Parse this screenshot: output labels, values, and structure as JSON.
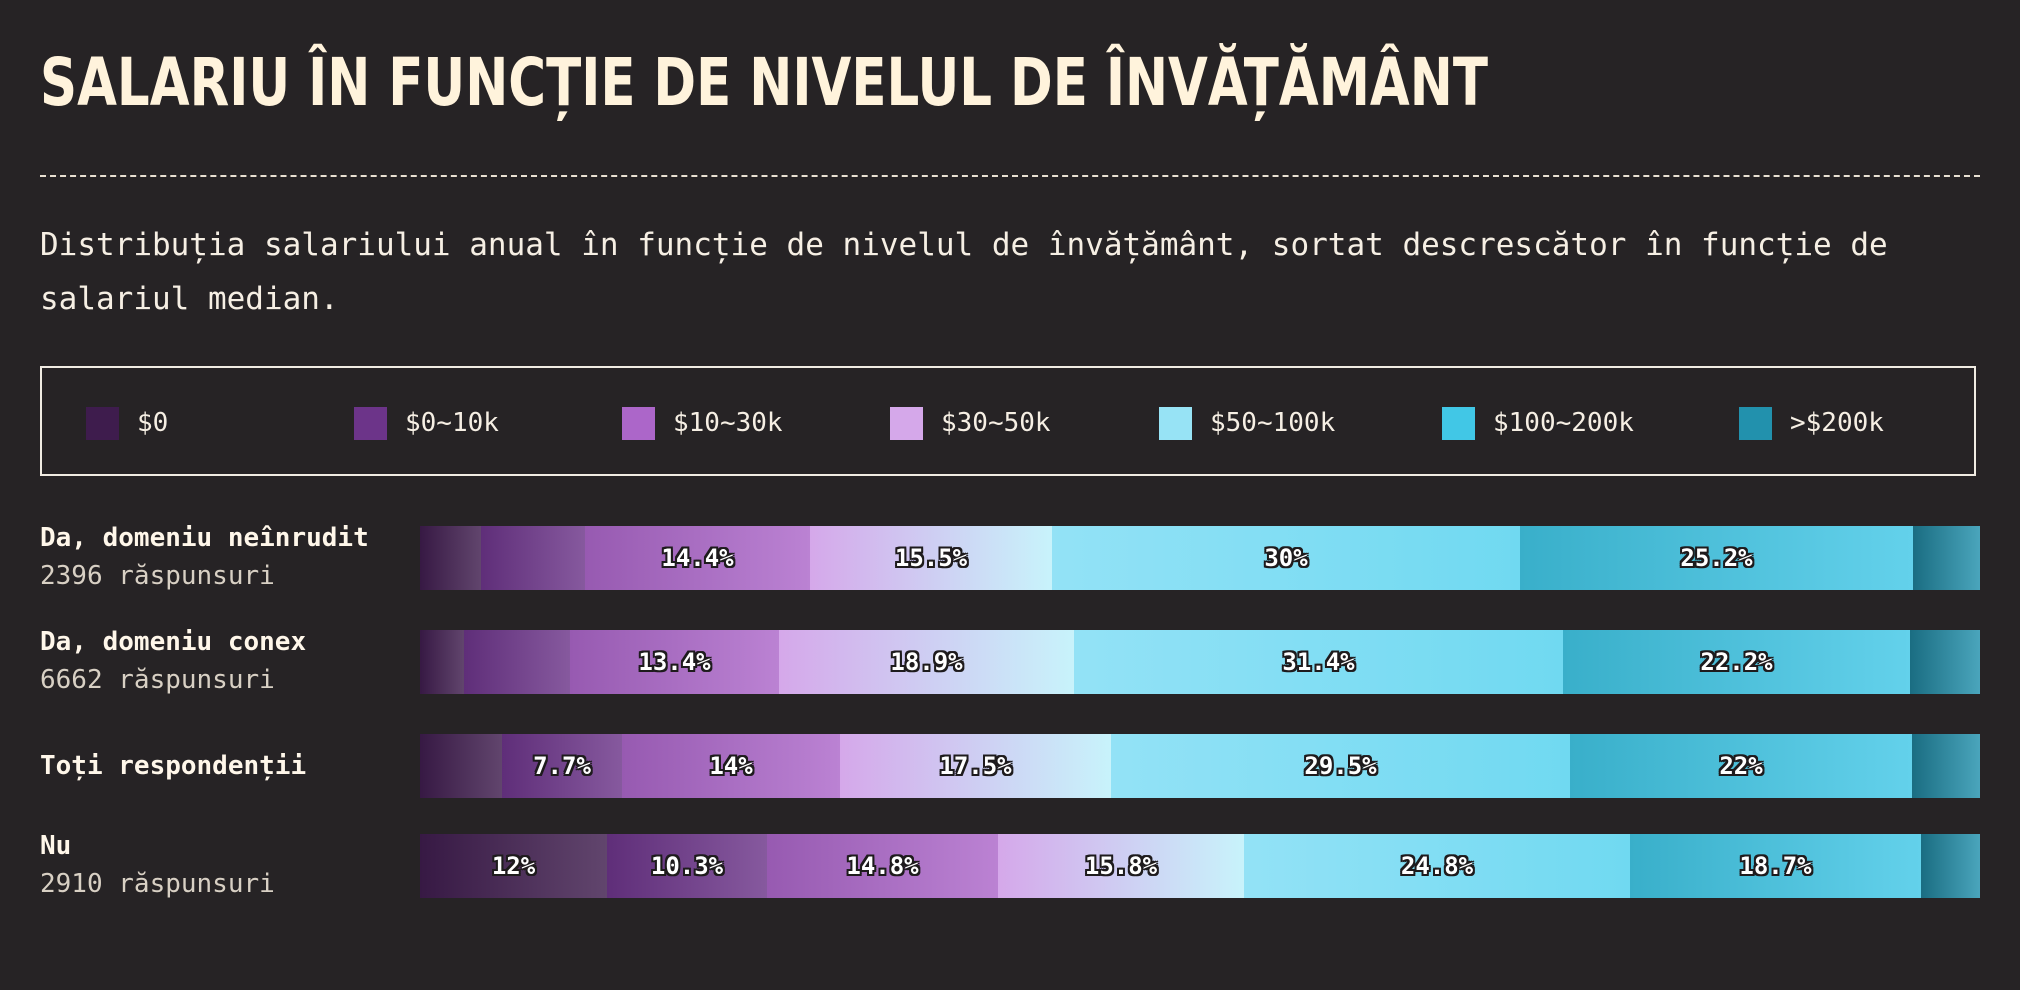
{
  "title": "SALARIU ÎN FUNCȚIE DE NIVELUL DE ÎNVĂȚĂMÂNT",
  "subtitle": "Distribuția salariului anual în funcție de nivelul de învățământ, sortat descrescător în funcție de salariul median.",
  "colors": {
    "background": "#262325",
    "text": "#fff3dc",
    "label_outline": "#1e1b1d"
  },
  "legend": [
    {
      "label": "$0",
      "color": "#3e1c4d"
    },
    {
      "label": "$0~10k",
      "color": "#6c3489"
    },
    {
      "label": "$10~30k",
      "color": "#ac66c9"
    },
    {
      "label": "$30~50k",
      "color": "#d5a8ea"
    },
    {
      "label": "$50~100k",
      "color": "#97e3f5"
    },
    {
      "label": "$100~200k",
      "color": "#41c7e6"
    },
    {
      "label": ">$200k",
      "color": "#2291ad"
    }
  ],
  "chart_data": {
    "type": "bar",
    "orientation": "horizontal",
    "stacked": true,
    "normalized": true,
    "title": "SALARIU ÎN FUNCȚIE DE NIVELUL DE ÎNVĂȚĂMÂNT",
    "subtitle": "Distribuția salariului anual în funcție de nivelul de învățământ, sortat descrescător în funcție de salariul median.",
    "xlim": [
      0,
      100
    ],
    "grid": false,
    "legend_position": "top",
    "series_names": [
      "$0",
      "$0~10k",
      "$10~30k",
      "$30~50k",
      "$50~100k",
      "$100~200k",
      ">$200k"
    ],
    "rows": [
      {
        "name": "Da, domeniu neînrudit",
        "count_text": "2396 răspunsuri",
        "values": [
          3.9,
          6.7,
          14.4,
          15.5,
          30,
          25.2,
          4.3
        ],
        "labels": [
          "",
          "",
          "14.4%",
          "15.5%",
          "30%",
          "25.2%",
          ""
        ]
      },
      {
        "name": "Da, domeniu conex",
        "count_text": "6662 răspunsuri",
        "values": [
          2.8,
          6.8,
          13.4,
          18.9,
          31.4,
          22.2,
          4.5
        ],
        "labels": [
          "",
          "",
          "13.4%",
          "18.9%",
          "31.4%",
          "22.2%",
          ""
        ]
      },
      {
        "name": "Toți respondenții",
        "count_text": "",
        "values": [
          5.3,
          7.7,
          14,
          17.5,
          29.5,
          22,
          4.4
        ],
        "labels": [
          "",
          "7.7%",
          "14%",
          "17.5%",
          "29.5%",
          "22%",
          ""
        ]
      },
      {
        "name": "Nu",
        "count_text": "2910 răspunsuri",
        "values": [
          12,
          10.3,
          14.8,
          15.8,
          24.8,
          18.7,
          3.8
        ],
        "labels": [
          "12%",
          "10.3%",
          "14.8%",
          "15.8%",
          "24.8%",
          "18.7%",
          ""
        ]
      }
    ]
  }
}
